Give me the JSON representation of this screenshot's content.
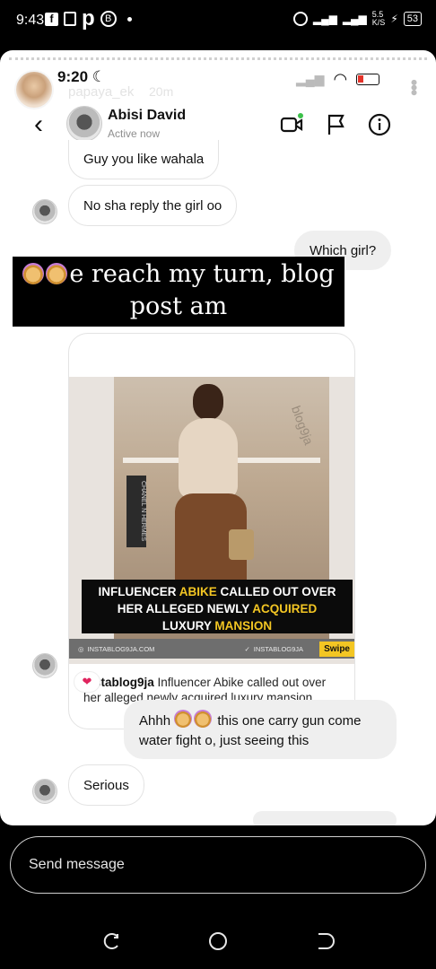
{
  "status_bar": {
    "time": "9:43",
    "data_speed": "5.5",
    "speed_unit": "K/S",
    "battery": "53"
  },
  "story": {
    "username": "papaya_ek",
    "ago": "20m"
  },
  "inner_screenshot": {
    "time": "9:20",
    "dm": {
      "name": "Abisi David",
      "status": "Active now"
    },
    "messages": [
      {
        "from": "them",
        "text": "Guy you like wahala"
      },
      {
        "from": "them",
        "text": "No sha reply the girl oo"
      },
      {
        "from": "me",
        "text": "Which girl?"
      },
      {
        "from": "me",
        "text": "Ahhh",
        "text_after": "this one carry gun come water fight o, just seeing this"
      },
      {
        "from": "them",
        "text": "Serious"
      }
    ],
    "shared_post": {
      "banner_line1_a": "INFLUENCER ",
      "banner_line1_b": "ABIKE",
      "banner_line1_c": " CALLED OUT OVER",
      "banner_line2_a": "HER ALLEGED NEWLY ",
      "banner_line2_b": "ACQUIRED",
      "banner_line3_a": "LUXURY ",
      "banner_line3_b": "MANSION",
      "site": "INSTABLOG9JA.COM",
      "handle": "INSTABLOG9JA",
      "swipe": "Swipe",
      "watermark": "blog9ja",
      "book_text": "CHANEL N HERMES",
      "account": "instablog9ja",
      "caption": "Influencer Abike called out over her alleged newly acquired luxury mansion",
      "reaction": "❤"
    }
  },
  "overlay_caption": {
    "line1": "e reach my turn, blog",
    "line2": "post am"
  },
  "composer": {
    "placeholder": "Send message"
  }
}
